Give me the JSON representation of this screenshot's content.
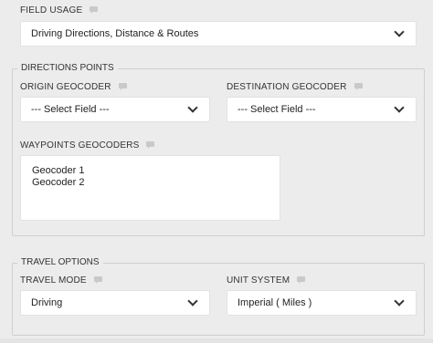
{
  "field_usage": {
    "label": "FIELD USAGE",
    "selected": "Driving Directions, Distance & Routes"
  },
  "directions_points": {
    "legend": "DIRECTIONS POINTS",
    "origin": {
      "label": "ORIGIN GEOCODER",
      "selected": "--- Select Field ---"
    },
    "destination": {
      "label": "DESTINATION GEOCODER",
      "selected": "--- Select Field ---"
    },
    "waypoints": {
      "label": "WAYPOINTS GEOCODERS",
      "options": [
        "Geocoder 1",
        "Geocoder 2"
      ]
    }
  },
  "travel_options": {
    "legend": "TRAVEL OPTIONS",
    "travel_mode": {
      "label": "TRAVEL MODE",
      "selected": "Driving"
    },
    "unit_system": {
      "label": "UNIT SYSTEM",
      "selected": "Imperial ( Miles )"
    }
  },
  "icons": {
    "help": "comment-help-icon",
    "dropdown": "chevron-down-icon"
  },
  "colors": {
    "background": "#ececec",
    "field_bg": "#ffffff",
    "border": "#cfcfcf",
    "help_icon": "#c9c9c9"
  }
}
